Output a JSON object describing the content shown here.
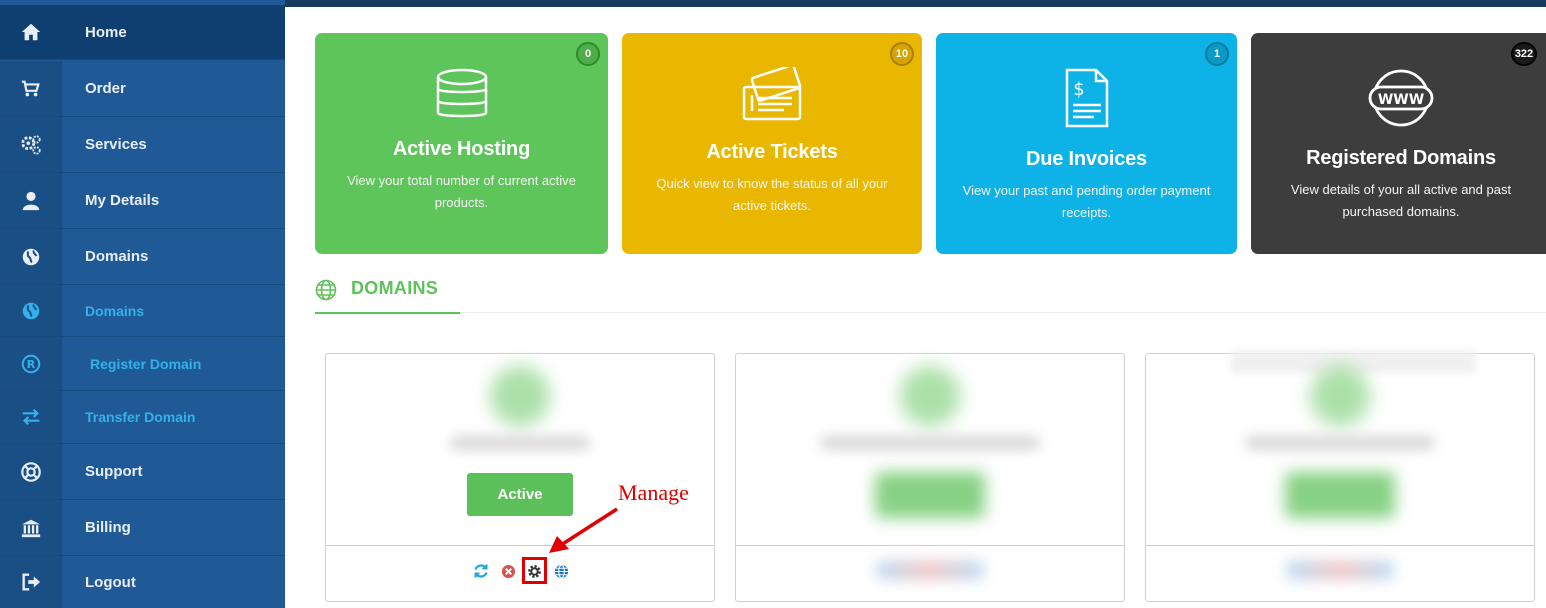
{
  "sidebar": {
    "items": [
      {
        "label": "Home",
        "icon": "home-icon"
      },
      {
        "label": "Order",
        "icon": "cart-icon"
      },
      {
        "label": "Services",
        "icon": "gears-icon"
      },
      {
        "label": "My Details",
        "icon": "user-icon"
      },
      {
        "label": "Domains",
        "icon": "globe-icon"
      },
      {
        "label": "Domains",
        "icon": "globe-icon"
      },
      {
        "label": "Register Domain",
        "icon": "registered-icon"
      },
      {
        "label": "Transfer Domain",
        "icon": "exchange-icon"
      },
      {
        "label": "Support",
        "icon": "lifebuoy-icon"
      },
      {
        "label": "Billing",
        "icon": "bank-icon"
      },
      {
        "label": "Logout",
        "icon": "logout-icon"
      }
    ]
  },
  "stats": [
    {
      "title": "Active Hosting",
      "desc": "View your total number of current active products.",
      "count": "0",
      "color": "#5ec55a",
      "icon": "database-icon"
    },
    {
      "title": "Active Tickets",
      "desc": "Quick view to know the  status of all your active tickets.",
      "count": "10",
      "color": "#eab700",
      "icon": "ticket-icon"
    },
    {
      "title": "Due Invoices",
      "desc": "View your past and pending order payment receipts.",
      "count": "1",
      "color": "#0db3e6",
      "icon": "invoice-icon"
    },
    {
      "title": "Registered Domains",
      "desc": "View details of your all active and past purchased domains.",
      "count": "322",
      "color": "#3d3d3d",
      "icon": "www-icon"
    }
  ],
  "section": {
    "title": "DOMAINS"
  },
  "domain_card": {
    "status_label": "Active"
  },
  "annotation": {
    "text": "Manage"
  },
  "colors": {
    "sidebar": "#1f5a96",
    "accent_green": "#5ec25a",
    "annotation_red": "#e00000"
  }
}
